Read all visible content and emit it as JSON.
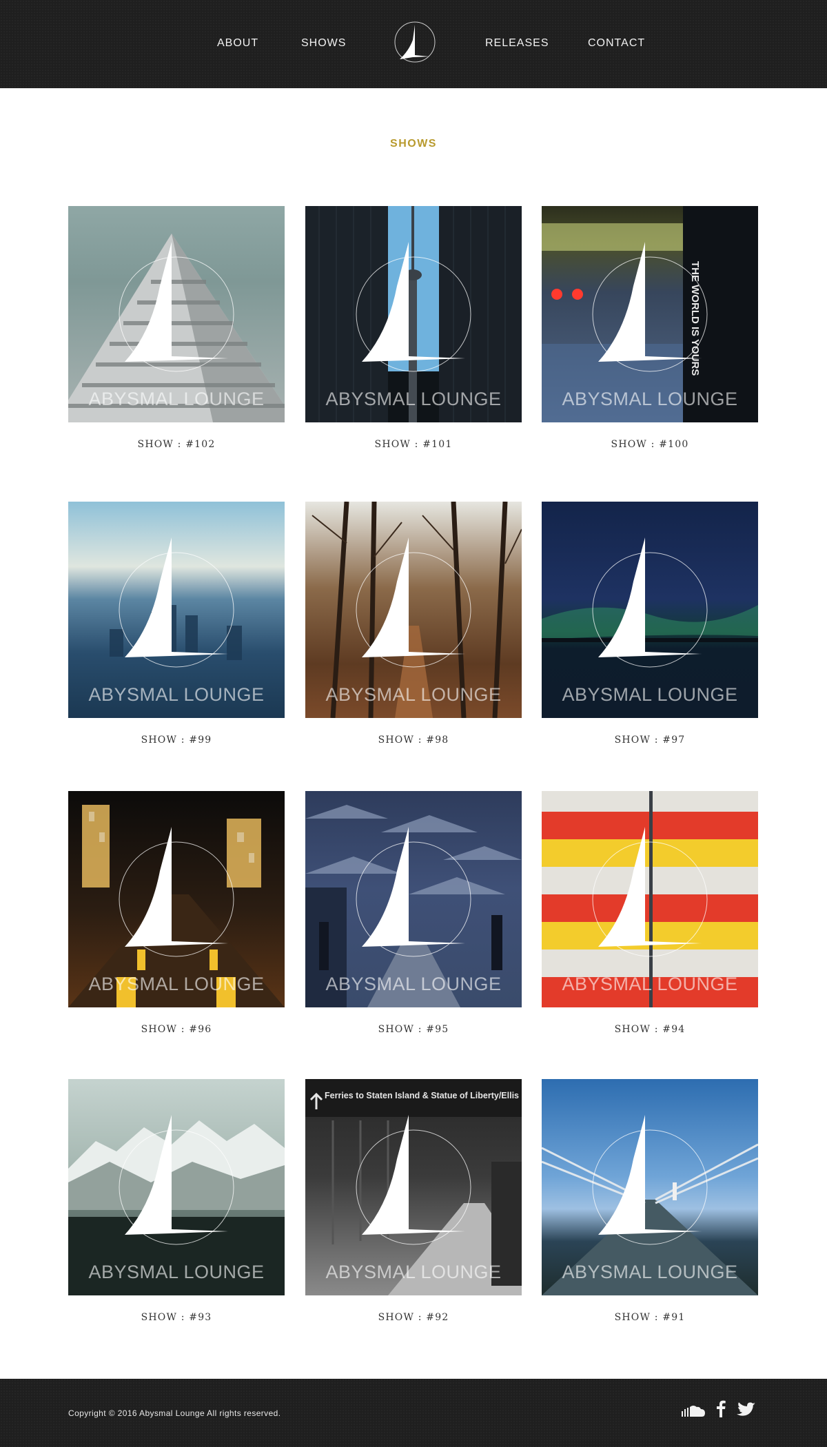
{
  "nav": {
    "about": "ABOUT",
    "shows": "SHOWS",
    "releases": "RELEASES",
    "contact": "CONTACT"
  },
  "page_title": "SHOWS",
  "brand_text": "ABYSMAL LOUNGE",
  "shows": [
    {
      "label": "SHOW : #102"
    },
    {
      "label": "SHOW : #101"
    },
    {
      "label": "SHOW : #100"
    },
    {
      "label": "SHOW : #99"
    },
    {
      "label": "SHOW : #98"
    },
    {
      "label": "SHOW : #97"
    },
    {
      "label": "SHOW : #96"
    },
    {
      "label": "SHOW : #95"
    },
    {
      "label": "SHOW : #94"
    },
    {
      "label": "SHOW : #93"
    },
    {
      "label": "SHOW : #92"
    },
    {
      "label": "SHOW : #91"
    }
  ],
  "artwork_text": {
    "ferry_sign": "Ferries to Staten Island & Statue of Liberty/Ellis Island",
    "shirt_text": "THE WORLD IS YOURS"
  },
  "footer": {
    "copyright": "Copyright © 2016 Abysmal Lounge All rights reserved.",
    "social_icons": [
      "soundcloud-icon",
      "facebook-icon",
      "twitter-icon"
    ]
  },
  "colors": {
    "header_bg": "#1f1f1f",
    "accent": "#b89a2e"
  }
}
